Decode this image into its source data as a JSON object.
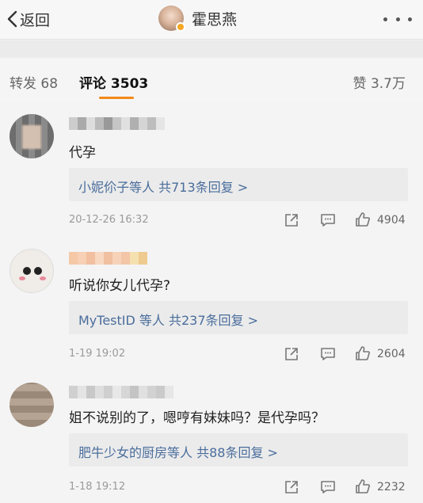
{
  "header": {
    "back_label": "返回",
    "title": "霍思燕"
  },
  "tabs": {
    "repost": "转发 68",
    "comments": "评论 3503",
    "likes": "赞 3.7万"
  },
  "colors": {
    "accent": "#f2891b",
    "link": "#4a6d9c",
    "verified": "#f5a623"
  },
  "comments": [
    {
      "text": "代孕",
      "reply_summary": "小妮伱子等人 共713条回复 >",
      "time": "20-12-26 16:32",
      "likes": "4904"
    },
    {
      "text": "听说你女儿代孕?",
      "reply_summary": "MyTestID 等人 共237条回复 >",
      "time": "1-19 19:02",
      "likes": "2604"
    },
    {
      "text": "姐不说别的了，嗯哼有妹妹吗？是代孕吗？",
      "reply_summary": "肥牛少女的厨房等人 共88条回复 >",
      "time": "1-18 19:12",
      "likes": "2232"
    }
  ],
  "icons": [
    "chevron-left-icon",
    "more-dots-icon",
    "share-icon",
    "reply-icon",
    "thumbs-up-icon",
    "verified-badge-icon"
  ]
}
